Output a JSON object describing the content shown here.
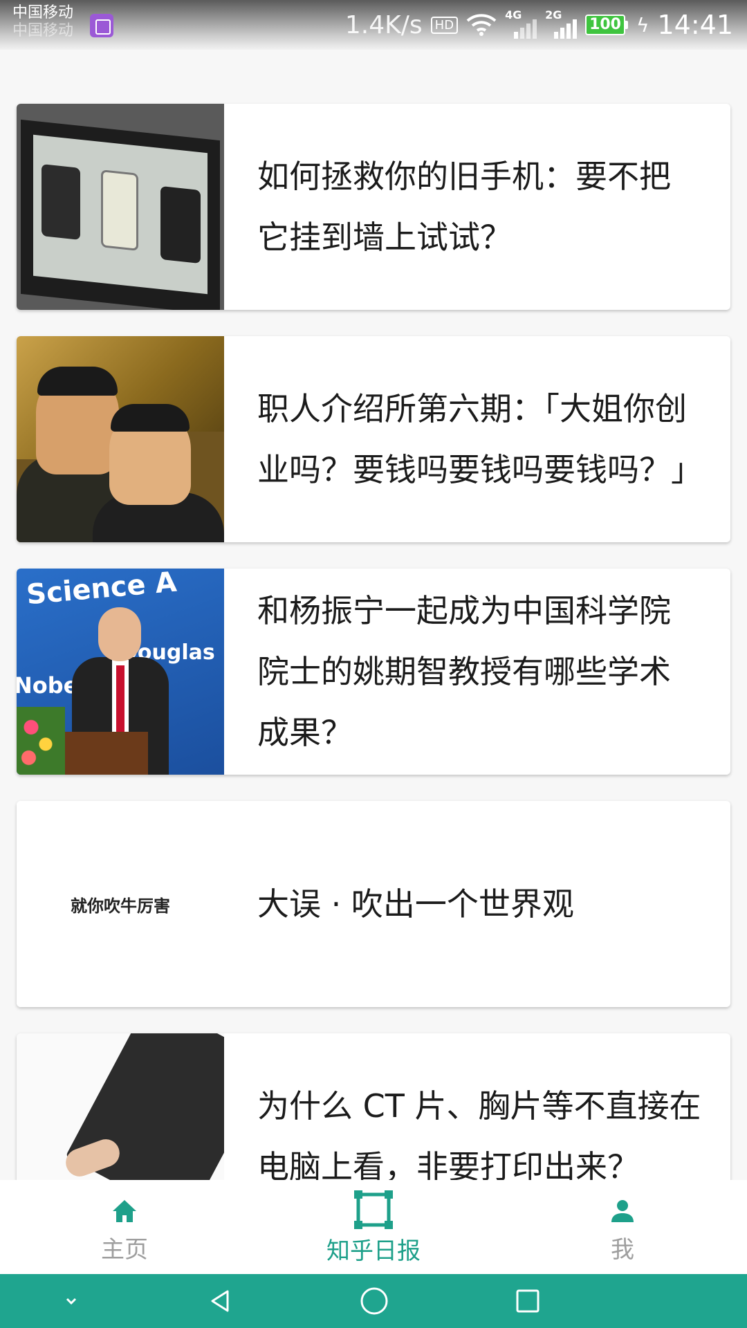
{
  "status_bar": {
    "carrier_1": "中国移动",
    "carrier_2": "中国移动",
    "net_speed": "1.4K/s",
    "hd": "HD",
    "network_1": "4G",
    "network_2": "2G",
    "battery": "100",
    "time": "14:41"
  },
  "feed": {
    "items": [
      {
        "title_line1": "如何拯救你的旧手机：要不把",
        "title_line2": "它挂到墙上试试？",
        "title_line3": ""
      },
      {
        "title_line1": "职人介绍所第六期：「大姐你创",
        "title_line2": "业吗？要钱吗要钱吗要钱吗？」",
        "title_line3": ""
      },
      {
        "title_line1": "和杨振宁一起成为中国科学院",
        "title_line2": "院士的姚期智教授有哪些学术",
        "title_line3": "成果？"
      },
      {
        "title_line1": "大误 · 吹出一个世界观",
        "title_line2": "",
        "title_line3": "",
        "thumb_text": "就你吹牛厉害"
      },
      {
        "title_line1": "为什么 CT 片、胸片等不直接在",
        "title_line2": "电脑上看，非要打印出来？",
        "title_line3": ""
      }
    ],
    "thumb_sci_text_1": "Science A",
    "thumb_sci_text_2": "Douglas C",
    "thumb_sci_text_3": "Nobel"
  },
  "bottom_nav": {
    "items": [
      {
        "label": "主页",
        "icon": "home-icon",
        "active": false
      },
      {
        "label": "知乎日报",
        "icon": "zhihu-daily-icon",
        "active": true
      },
      {
        "label": "我",
        "icon": "person-icon",
        "active": false
      }
    ]
  },
  "colors": {
    "accent": "#1ea08a",
    "system_nav": "#1fa58f",
    "inactive": "#9e9e9e",
    "title": "#1b1b1b"
  }
}
